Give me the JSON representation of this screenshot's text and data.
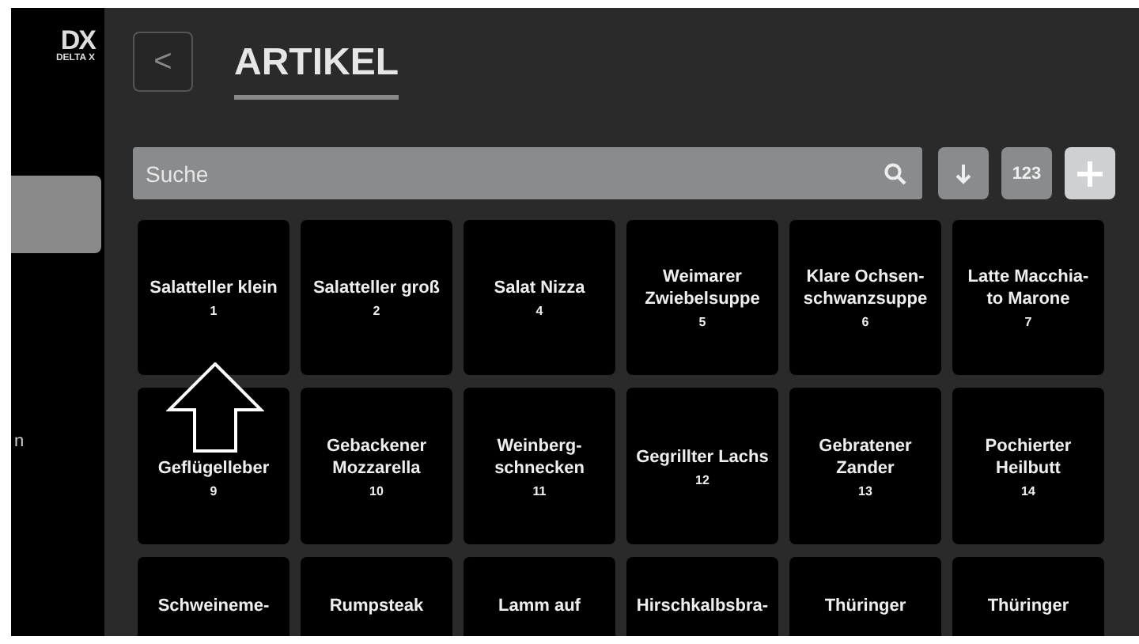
{
  "sidebar": {
    "logo": {
      "mark": "DX",
      "name": "DELTA X"
    },
    "items": [
      {
        "selected": true
      },
      {
        "label": "n",
        "selected": false
      }
    ]
  },
  "header": {
    "back": "<",
    "title": "ARTIKEL"
  },
  "search": {
    "placeholder": "Suche"
  },
  "tools": [
    {
      "kind": "sort"
    },
    {
      "kind": "text",
      "label": "123"
    },
    {
      "kind": "add"
    }
  ],
  "tiles": [
    {
      "lines": [
        "Salatteller klein"
      ],
      "number": "1"
    },
    {
      "lines": [
        "Salatteller groß"
      ],
      "number": "2"
    },
    {
      "lines": [
        "Salat Nizza"
      ],
      "number": "4"
    },
    {
      "lines": [
        "Weimarer",
        "Zwiebelsuppe"
      ],
      "number": "5"
    },
    {
      "lines": [
        "Klare Ochsen-",
        "schwanzsuppe"
      ],
      "number": "6"
    },
    {
      "lines": [
        "Latte Macchia-",
        "to Marone"
      ],
      "number": "7"
    },
    {
      "lines": [
        "Geflügelleber"
      ],
      "number": "9",
      "covered": true
    },
    {
      "lines": [
        "Gebackener",
        "Mozzarella"
      ],
      "number": "10"
    },
    {
      "lines": [
        "Weinberg-",
        "schnecken"
      ],
      "number": "11"
    },
    {
      "lines": [
        "Gegrillter Lachs"
      ],
      "number": "12"
    },
    {
      "lines": [
        "Gebratener",
        "Zander"
      ],
      "number": "13"
    },
    {
      "lines": [
        "Pochierter",
        "Heilbutt"
      ],
      "number": "14"
    },
    {
      "lines": [
        "Schweineme-"
      ]
    },
    {
      "lines": [
        "Rumpsteak"
      ]
    },
    {
      "lines": [
        "Lamm auf"
      ]
    },
    {
      "lines": [
        "Hirschkalbsbra-"
      ]
    },
    {
      "lines": [
        "Thüringer"
      ]
    },
    {
      "lines": [
        "Thüringer"
      ]
    }
  ]
}
